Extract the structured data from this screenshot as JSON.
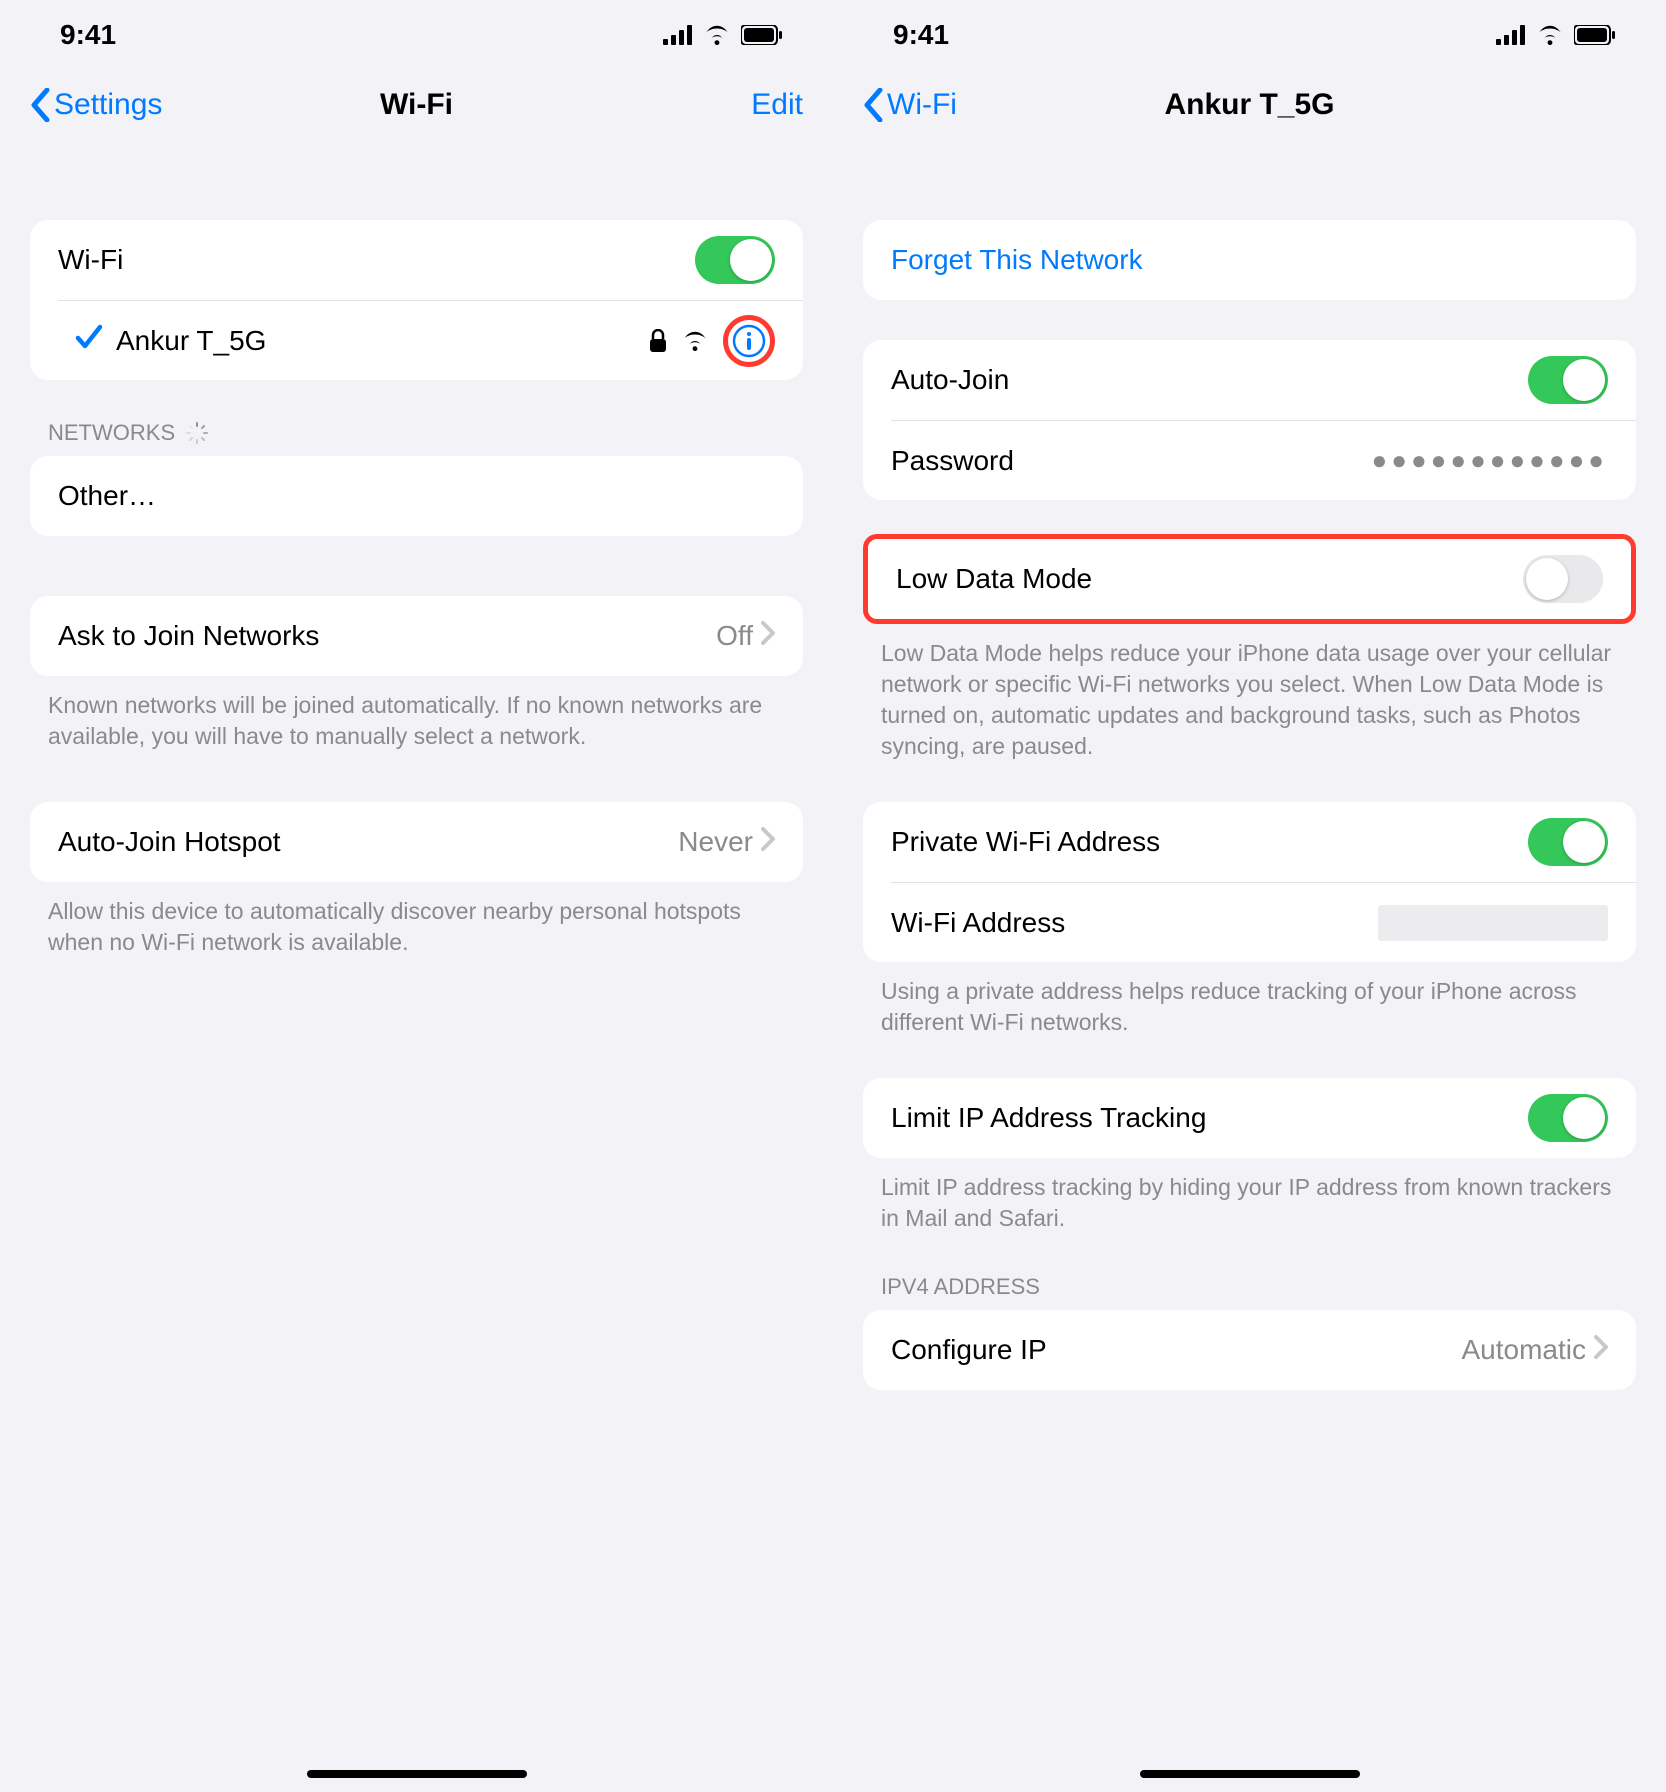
{
  "status": {
    "time": "9:41"
  },
  "left": {
    "nav": {
      "back": "Settings",
      "title": "Wi-Fi",
      "edit": "Edit"
    },
    "wifi_row": "Wi-Fi",
    "connected_name": "Ankur T_5G",
    "networks_header": "NETWORKS",
    "other_label": "Other…",
    "ask": {
      "label": "Ask to Join Networks",
      "value": "Off"
    },
    "ask_footer": "Known networks will be joined automatically. If no known networks are available, you will have to manually select a network.",
    "hotspot": {
      "label": "Auto-Join Hotspot",
      "value": "Never"
    },
    "hotspot_footer": "Allow this device to automatically discover nearby personal hotspots when no Wi-Fi network is available."
  },
  "right": {
    "nav": {
      "back": "Wi-Fi",
      "title": "Ankur T_5G"
    },
    "forget": "Forget This Network",
    "autojoin": "Auto-Join",
    "password": "Password",
    "password_dots": "●●●●●●●●●●●●",
    "lowdata": "Low Data Mode",
    "lowdata_footer": "Low Data Mode helps reduce your iPhone data usage over your cellular network or specific Wi-Fi networks you select. When Low Data Mode is turned on, automatic updates and background tasks, such as Photos syncing, are paused.",
    "private_addr": "Private Wi-Fi Address",
    "wifi_addr": "Wi-Fi Address",
    "private_footer": "Using a private address helps reduce tracking of your iPhone across different Wi-Fi networks.",
    "limit_ip": "Limit IP Address Tracking",
    "limit_ip_footer": "Limit IP address tracking by hiding your IP address from known trackers in Mail and Safari.",
    "ipv4_header": "IPV4 ADDRESS",
    "configure_ip": {
      "label": "Configure IP",
      "value": "Automatic"
    }
  }
}
